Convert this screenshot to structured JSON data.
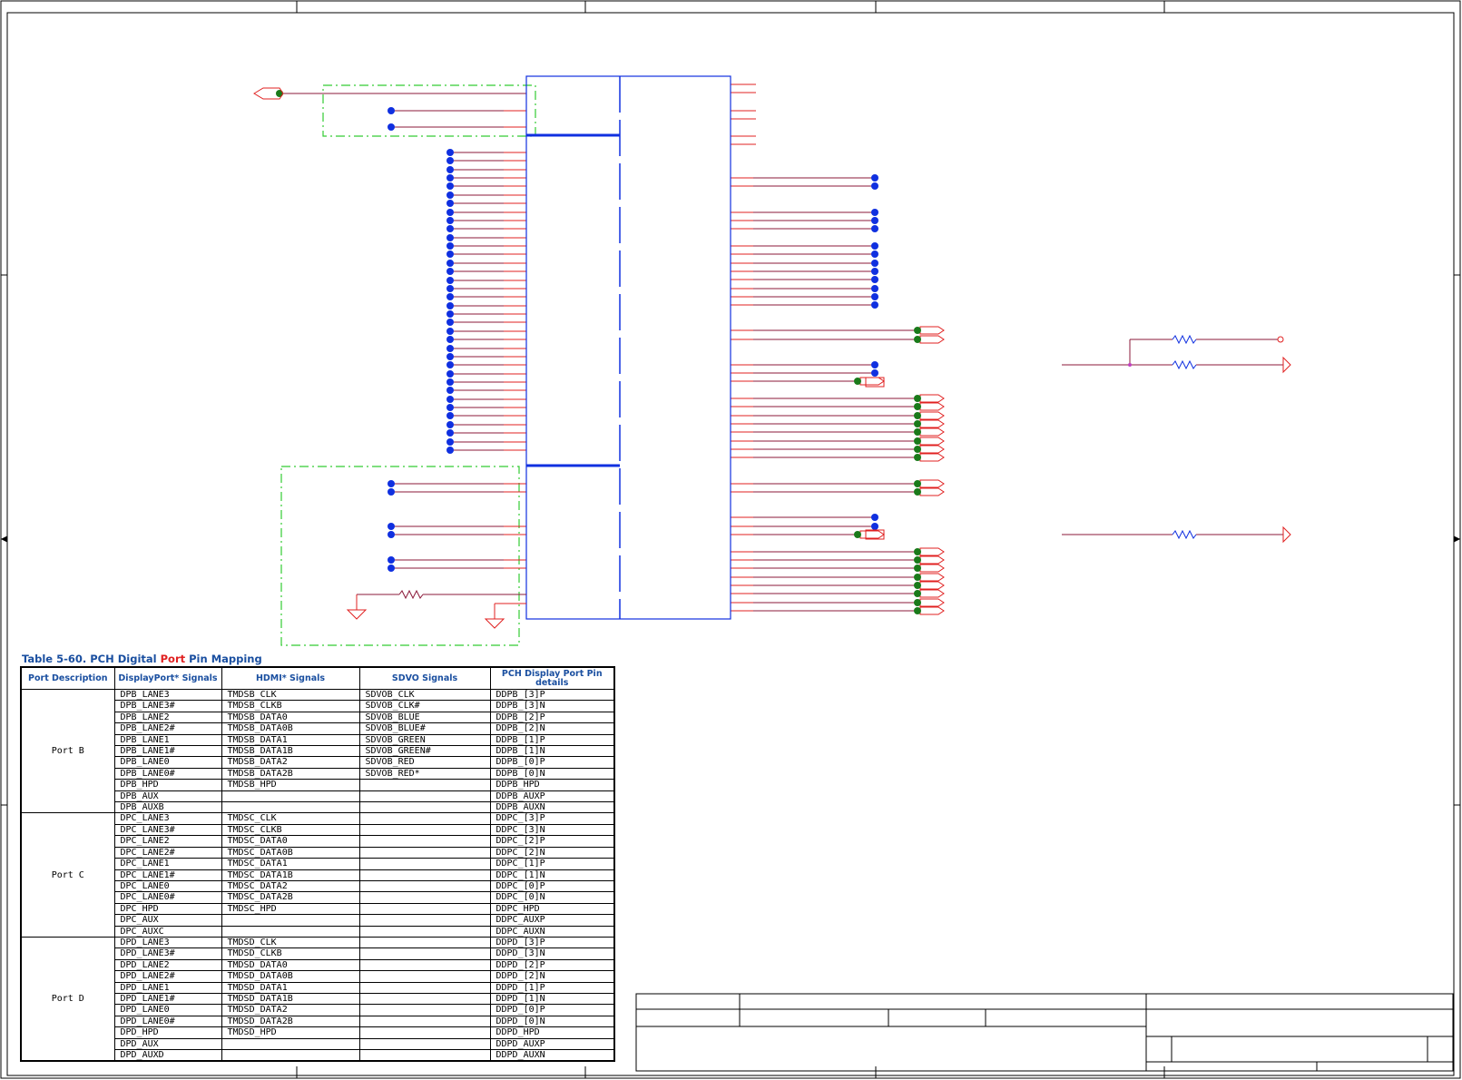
{
  "table": {
    "caption_prefix": "Table 5-60.  PCH Digital ",
    "caption_highlight": "Port",
    "caption_suffix": " Pin Mapping",
    "headers": [
      "Port Description",
      "DisplayPort* Signals",
      "HDMI* Signals",
      "SDVO Signals",
      "PCH Display Port Pin details"
    ],
    "groups": [
      {
        "port": "Port B",
        "rows": [
          [
            "DPB_LANE3",
            "TMDSB_CLK",
            "SDVOB_CLK",
            "DDPB_[3]P"
          ],
          [
            "DPB_LANE3#",
            "TMDSB_CLKB",
            "SDVOB_CLK#",
            "DDPB_[3]N"
          ],
          [
            "DPB_LANE2",
            "TMDSB_DATA0",
            "SDVOB_BLUE",
            "DDPB_[2]P"
          ],
          [
            "DPB_LANE2#",
            "TMDSB_DATA0B",
            "SDVOB_BLUE#",
            "DDPB_[2]N"
          ],
          [
            "DPB_LANE1",
            "TMDSB_DATA1",
            "SDVOB_GREEN",
            "DDPB_[1]P"
          ],
          [
            "DPB_LANE1#",
            "TMDSB_DATA1B",
            "SDVOB_GREEN#",
            "DDPB_[1]N"
          ],
          [
            "DPB_LANE0",
            "TMDSB_DATA2",
            "SDVOB_RED",
            "DDPB_[0]P"
          ],
          [
            "DPB_LANE0#",
            "TMDSB_DATA2B",
            "SDVOB_RED*",
            "DDPB_[0]N"
          ],
          [
            "DPB_HPD",
            "TMDSB_HPD",
            "",
            "DDPB_HPD"
          ],
          [
            "DPB_AUX",
            "",
            "",
            "DDPB_AUXP"
          ],
          [
            "DPB_AUXB",
            "",
            "",
            "DDPB_AUXN"
          ]
        ]
      },
      {
        "port": "Port C",
        "rows": [
          [
            "DPC_LANE3",
            "TMDSC_CLK",
            "",
            "DDPC_[3]P"
          ],
          [
            "DPC_LANE3#",
            "TMDSC_CLKB",
            "",
            "DDPC_[3]N"
          ],
          [
            "DPC_LANE2",
            "TMDSC_DATA0",
            "",
            "DDPC_[2]P"
          ],
          [
            "DPC_LANE2#",
            "TMDSC_DATA0B",
            "",
            "DDPC_[2]N"
          ],
          [
            "DPC_LANE1",
            "TMDSC_DATA1",
            "",
            "DDPC_[1]P"
          ],
          [
            "DPC_LANE1#",
            "TMDSC_DATA1B",
            "",
            "DDPC_[1]N"
          ],
          [
            "DPC_LANE0",
            "TMDSC_DATA2",
            "",
            "DDPC_[0]P"
          ],
          [
            "DPC_LANE0#",
            "TMDSC_DATA2B",
            "",
            "DDPC_[0]N"
          ],
          [
            "DPC_HPD",
            "TMDSC_HPD",
            "",
            "DDPC_HPD"
          ],
          [
            "DPC_AUX",
            "",
            "",
            "DDPC_AUXP"
          ],
          [
            "DPC_AUXC",
            "",
            "",
            "DDPC_AUXN"
          ]
        ]
      },
      {
        "port": "Port D",
        "rows": [
          [
            "DPD_LANE3",
            "TMDSD_CLK",
            "",
            "DDPD_[3]P"
          ],
          [
            "DPD_LANE3#",
            "TMDSD_CLKB",
            "",
            "DDPD_[3]N"
          ],
          [
            "DPD_LANE2",
            "TMDSD_DATA0",
            "",
            "DDPD_[2]P"
          ],
          [
            "DPD_LANE2#",
            "TMDSD_DATA0B",
            "",
            "DDPD_[2]N"
          ],
          [
            "DPD_LANE1",
            "TMDSD_DATA1",
            "",
            "DDPD_[1]P"
          ],
          [
            "DPD_LANE1#",
            "TMDSD_DATA1B",
            "",
            "DDPD_[1]N"
          ],
          [
            "DPD_LANE0",
            "TMDSD_DATA2",
            "",
            "DDPD_[0]P"
          ],
          [
            "DPD_LANE0#",
            "TMDSD_DATA2B",
            "",
            "DDPD_[0]N"
          ],
          [
            "DPD_HPD",
            "TMDSD_HPD",
            "",
            "DDPD_HPD"
          ],
          [
            "DPD_AUX",
            "",
            "",
            "DDPD_AUXP"
          ],
          [
            "DPD_AUXD",
            "",
            "",
            "DDPD_AUXN"
          ]
        ]
      }
    ]
  },
  "colors": {
    "wire": "#e02020",
    "net": "#8b1a3a",
    "pin_dot": "#1030e0",
    "connector_dot": "#1a7a1a",
    "chip_outline": "#1030e0",
    "dash_box": "#33cc33",
    "table_header": "#1a4fa0"
  }
}
